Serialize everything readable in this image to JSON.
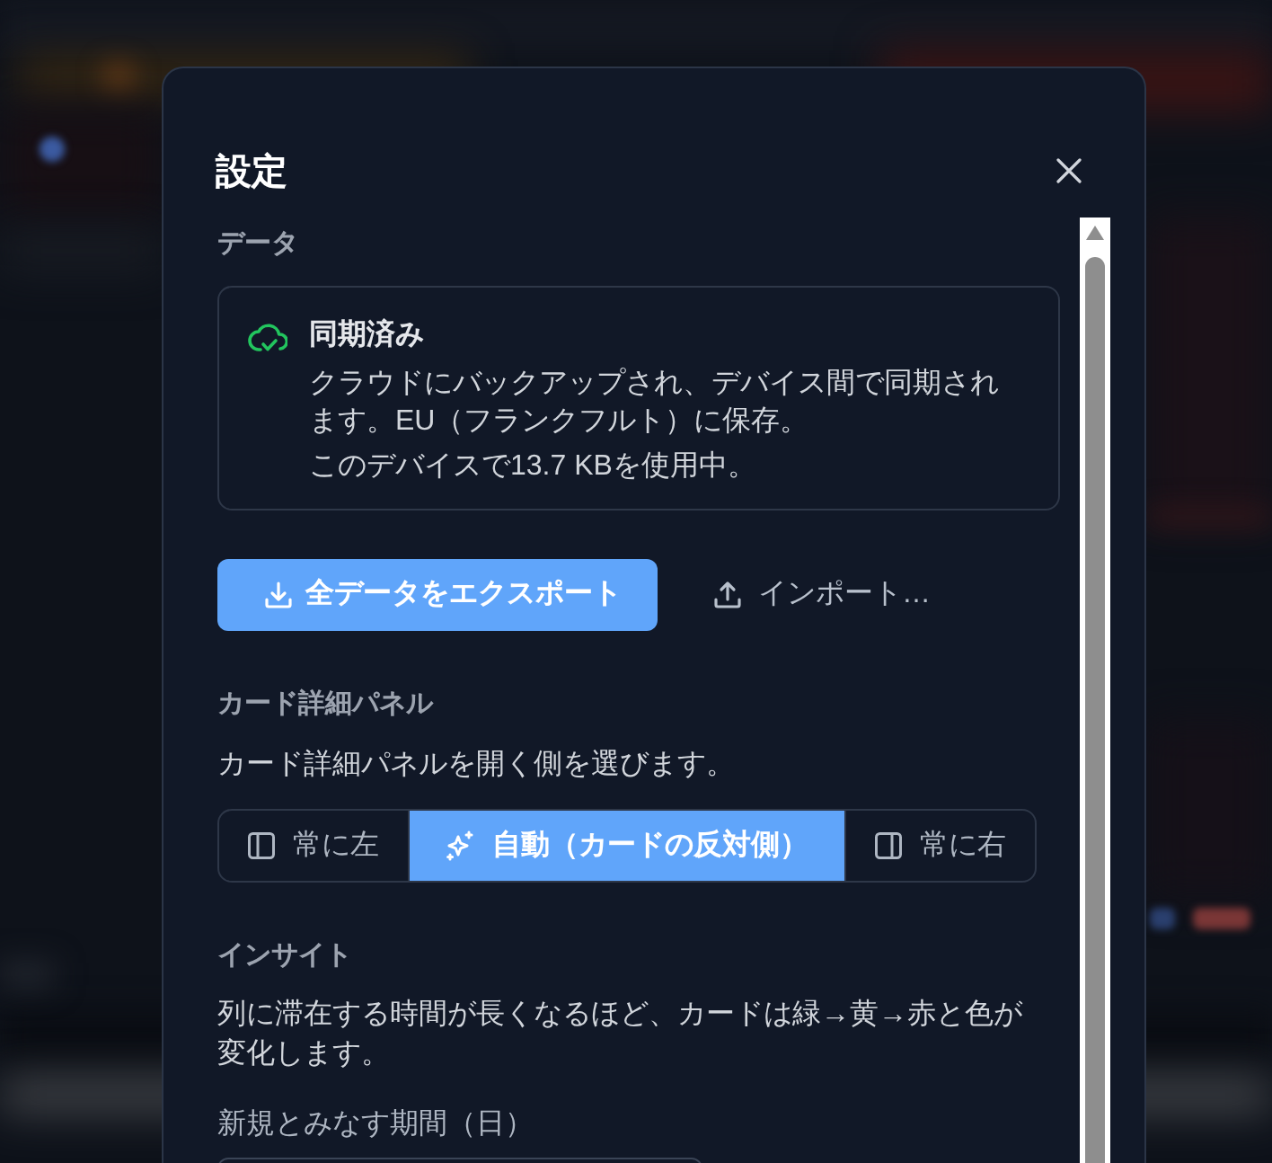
{
  "dialog": {
    "title": "設定"
  },
  "sections": [
    {
      "kind": "sync",
      "heading": "データ",
      "status": {
        "title": "同期済み",
        "description": "クラウドにバックアップされ、デバイス間で同期されます。EU（フランクフルト）に保存。",
        "usage": "このデバイスで13.7 KBを使用中。"
      },
      "actions": [
        {
          "kind": "export",
          "label": "全データをエクスポート"
        },
        {
          "kind": "import",
          "label": "インポート…"
        }
      ]
    },
    {
      "kind": "choice",
      "heading": "カード詳細パネル",
      "description": "カード詳細パネルを開く側を選びます。",
      "options": [
        {
          "kind": "left",
          "label": "常に左",
          "selected": false
        },
        {
          "kind": "auto",
          "label": "自動（カードの反対側）",
          "selected": true
        },
        {
          "kind": "right",
          "label": "常に右",
          "selected": false
        }
      ]
    },
    {
      "kind": "insight",
      "heading": "インサイト",
      "description": "列に滞在する時間が長くなるほど、カードは緑→黄→赤と色が変化します。",
      "fields": [
        {
          "label": "新規とみなす期間（日）"
        }
      ]
    }
  ]
}
